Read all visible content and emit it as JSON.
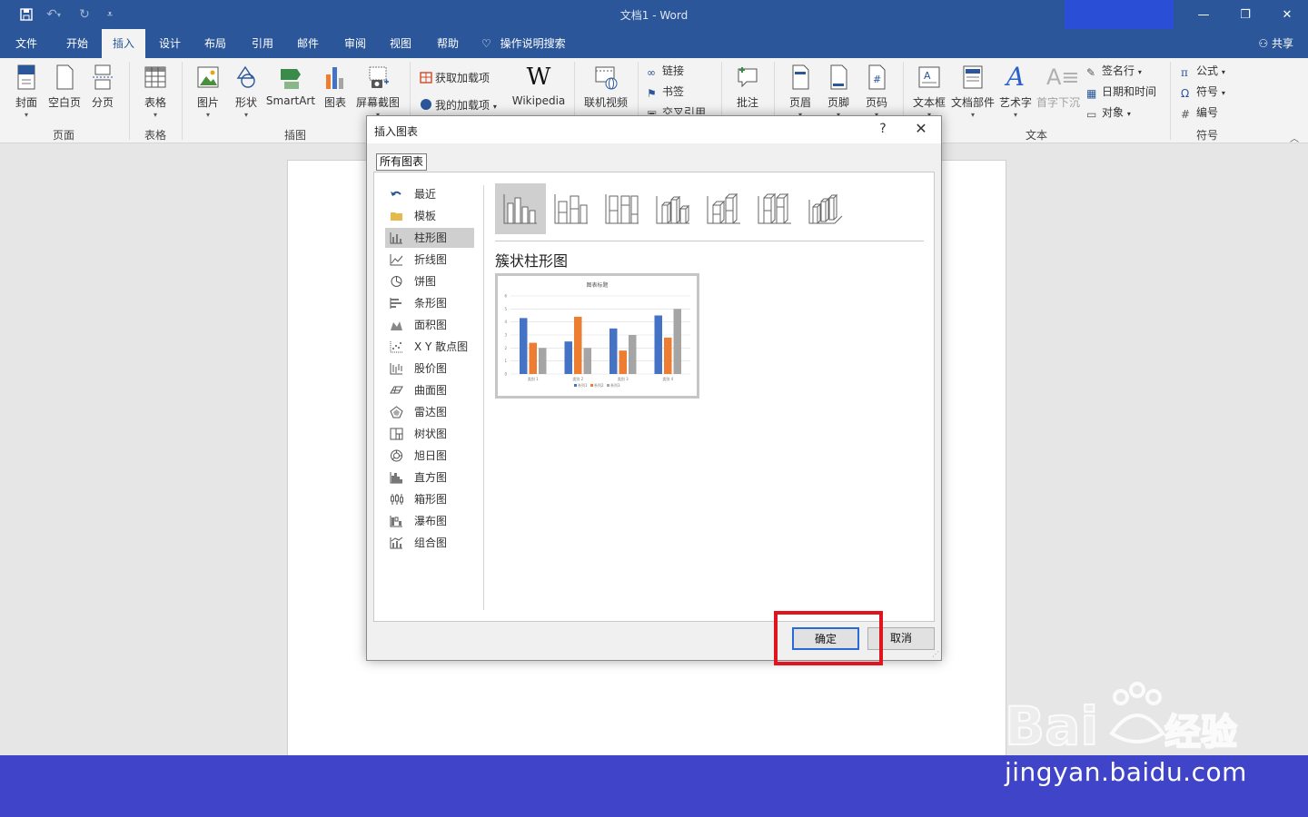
{
  "window": {
    "title": "文档1  -  Word",
    "controls": [
      "—",
      "❐",
      "✕"
    ]
  },
  "tabs": [
    "文件",
    "开始",
    "插入",
    "设计",
    "布局",
    "引用",
    "邮件",
    "审阅",
    "视图",
    "帮助"
  ],
  "active_tab": "插入",
  "tell_me": "操作说明搜索",
  "share": "共享",
  "ribbon": {
    "pages": {
      "cover": "封面",
      "blank": "空白页",
      "break": "分页",
      "label": "页面"
    },
    "tables": {
      "table": "表格",
      "label": "表格"
    },
    "illustrations": {
      "picture": "图片",
      "shapes": "形状",
      "smartart": "SmartArt",
      "chart": "图表",
      "screenshot": "屏幕截图",
      "label": "插图"
    },
    "addins": {
      "get": "获取加载项",
      "mine": "我的加载项",
      "wikipedia": "Wikipedia"
    },
    "media": {
      "online_video": "联机视频"
    },
    "links": {
      "link": "链接",
      "bookmark": "书签",
      "crossref": "交叉引用"
    },
    "comments": {
      "comment": "批注"
    },
    "headerfooter": {
      "header": "页眉",
      "footer": "页脚",
      "pagenum": "页码"
    },
    "text": {
      "textbox": "文本框",
      "quickparts": "文档部件",
      "wordart": "艺术字",
      "dropcap": "首字下沉",
      "signature": "签名行",
      "datetime": "日期和时间",
      "object": "对象",
      "label": "文本"
    },
    "symbols": {
      "equation": "公式",
      "symbol": "符号",
      "number": "编号",
      "label": "符号"
    }
  },
  "dialog": {
    "title": "插入图表",
    "help": "?",
    "close": "✕",
    "tab": "所有图表",
    "categories": [
      "最近",
      "模板",
      "柱形图",
      "折线图",
      "饼图",
      "条形图",
      "面积图",
      "X Y 散点图",
      "股价图",
      "曲面图",
      "雷达图",
      "树状图",
      "旭日图",
      "直方图",
      "箱形图",
      "瀑布图",
      "组合图"
    ],
    "selected_category": "柱形图",
    "selected_subtype": "簇状柱形图",
    "ok": "确定",
    "cancel": "取消"
  },
  "chart_data": {
    "type": "bar",
    "title": "图表标题",
    "categories": [
      "类别 1",
      "类别 2",
      "类别 3",
      "类别 4"
    ],
    "series": [
      {
        "name": "系列1",
        "values": [
          4.3,
          2.5,
          3.5,
          4.5
        ],
        "color": "#4472c4"
      },
      {
        "name": "系列2",
        "values": [
          2.4,
          4.4,
          1.8,
          2.8
        ],
        "color": "#ed7d31"
      },
      {
        "name": "系列3",
        "values": [
          2,
          2,
          3,
          5
        ],
        "color": "#a5a5a5"
      }
    ],
    "ylim": [
      0,
      6
    ],
    "yticks": [
      "0",
      "1",
      "2",
      "3",
      "4",
      "5",
      "6"
    ],
    "grid": true,
    "legend": "bottom"
  },
  "watermark": {
    "text": "jingyan.baidu.com",
    "logo": "Baidu经验"
  },
  "colors": {
    "accent": "#2b579a",
    "highlight": "#e0141e",
    "band": "#3f44c9"
  }
}
